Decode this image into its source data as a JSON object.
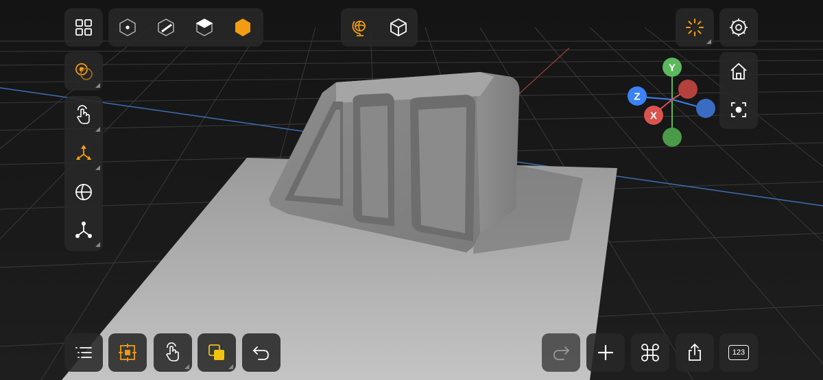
{
  "colors": {
    "accent": "#f39c12",
    "axis_x": "#d9534f",
    "axis_y": "#5cb85c",
    "axis_z": "#3b82f6",
    "panel": "#282828"
  },
  "gizmo": {
    "y_label": "Y",
    "z_label": "Z",
    "x_label": "X"
  },
  "toolbar_top_left": {
    "grid_menu": "grid-icon",
    "modes": [
      "vertex-mode-icon",
      "edge-mode-icon",
      "face-mode-icon",
      "object-mode-icon"
    ]
  },
  "toolbar_top_center": [
    "world-space-icon",
    "local-space-icon"
  ],
  "toolbar_top_right": [
    "snap-icon",
    "settings-icon"
  ],
  "sidebar_left": [
    "pivot-icon",
    "touch-select-icon",
    "move-tool-icon",
    "rotate-tool-icon",
    "scale-tool-icon"
  ],
  "sidebar_right": [
    "home-view-icon",
    "focus-icon"
  ],
  "toolbar_bottom_left": [
    "list-icon",
    "frame-selection-icon",
    "touch-icon",
    "layers-icon",
    "undo-icon"
  ],
  "toolbar_bottom_right": {
    "items": [
      "redo-icon",
      "add-icon",
      "command-icon",
      "share-icon",
      "numeric-icon"
    ],
    "numeric_label": "123"
  }
}
